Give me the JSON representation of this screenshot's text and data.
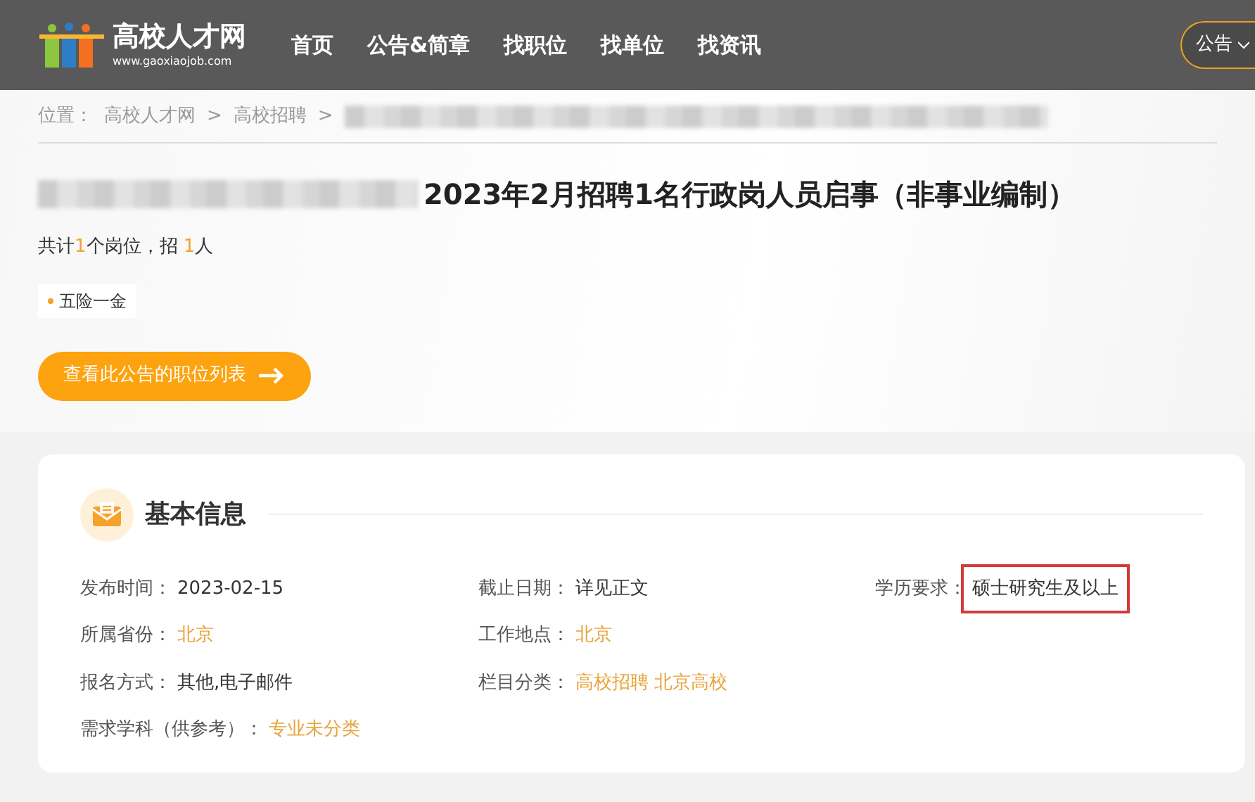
{
  "navbar": {
    "logo": {
      "title": "高校人才网",
      "subtitle": "www.gaoxiaojob.com"
    },
    "menu": [
      "首页",
      "公告&简章",
      "找职位",
      "找单位",
      "找资讯"
    ],
    "search_scope": {
      "label": "公告"
    }
  },
  "breadcrumb": {
    "label": "位置：",
    "items": [
      {
        "text": "高校人才网",
        "separator": ">"
      },
      {
        "text": "高校招聘",
        "separator": ">"
      }
    ],
    "redacted": true
  },
  "announcement": {
    "title_redacted": true,
    "title": "2023年2月招聘1名行政岗人员启事（非事业编制）",
    "summary": [
      {
        "kind": "plain",
        "text": "共计"
      },
      {
        "kind": "number",
        "text": "1"
      },
      {
        "kind": "plain",
        "text": "个岗位，招 "
      },
      {
        "kind": "number",
        "text": "1"
      },
      {
        "kind": "plain",
        "text": "人"
      }
    ],
    "tags": [
      "五险一金"
    ],
    "button": {
      "label": "查看此公告的职位列表"
    }
  },
  "basic_info": {
    "title": "基本信息",
    "rows": [
      [
        {
          "label": "发布时间：",
          "kind": "text",
          "values": [
            "2023-02-15"
          ],
          "highlighted": false
        },
        {
          "label": "截止日期：",
          "kind": "text",
          "values": [
            "详见正文"
          ],
          "highlighted": false
        },
        {
          "label": "学历要求：",
          "kind": "text",
          "values": [
            "硕士研究生及以上"
          ],
          "highlighted": true
        }
      ],
      [
        {
          "label": "所属省份：",
          "kind": "link",
          "values": [
            "北京"
          ],
          "highlighted": false
        },
        {
          "label": "工作地点：",
          "kind": "link",
          "values": [
            "北京"
          ],
          "highlighted": false
        }
      ],
      [
        {
          "label": "报名方式：",
          "kind": "text",
          "values": [
            "其他,电子邮件"
          ],
          "highlighted": false
        },
        {
          "label": "栏目分类：",
          "kind": "link",
          "values": [
            "高校招聘",
            "北京高校"
          ],
          "highlighted": false
        }
      ],
      [
        {
          "label": "需求学科（供参考）：",
          "kind": "link",
          "values": [
            "专业未分类"
          ],
          "highlighted": false
        }
      ]
    ]
  }
}
